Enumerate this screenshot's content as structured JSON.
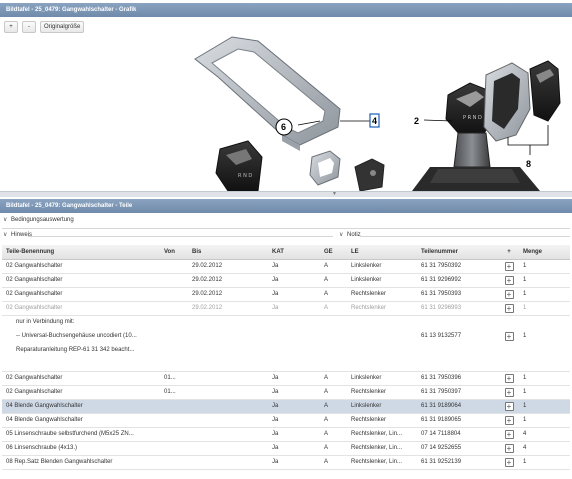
{
  "graphic_panel": {
    "title": "Bildtafel - 25_0479: Gangwahlschalter - Grafik",
    "zoom_in_label": "+",
    "zoom_out_label": "-",
    "original_size_label": "Originalgröße",
    "callouts": [
      "6",
      "4",
      "2",
      "8"
    ]
  },
  "parts_panel": {
    "title": "Bildtafel - 25_0479: Gangwahlschalter - Teile",
    "condition_label": "Bedingungsauswertung",
    "hint_label": "Hinweis",
    "note_label": "Notiz",
    "columns": [
      "Teile-Benennung",
      "Von",
      "Bis",
      "KAT",
      "GE",
      "LE",
      "Teilenummer",
      "+",
      "Menge"
    ],
    "rows": [
      {
        "name": "02 Gangwahlschalter",
        "von": "",
        "bis": "29.02.2012",
        "kat": "Ja",
        "ge": "A",
        "le": "Linkslenker",
        "tn": "61 31 7950392",
        "cart": "+",
        "menge": "1",
        "state": "normal"
      },
      {
        "name": "02 Gangwahlschalter",
        "von": "",
        "bis": "29.02.2012",
        "kat": "Ja",
        "ge": "A",
        "le": "Linkslenker",
        "tn": "61 31 9296992",
        "cart": "+",
        "menge": "1",
        "state": "normal"
      },
      {
        "name": "02 Gangwahlschalter",
        "von": "",
        "bis": "29.02.2012",
        "kat": "Ja",
        "ge": "A",
        "le": "Rechtslenker",
        "tn": "61 31 7950393",
        "cart": "+",
        "menge": "1",
        "state": "normal"
      },
      {
        "name": "02 Gangwahlschalter",
        "von": "",
        "bis": "29.02.2012",
        "kat": "Ja",
        "ge": "A",
        "le": "Rechtslenker",
        "tn": "61 31 9296993",
        "cart": "+",
        "menge": "1",
        "state": "dim"
      },
      {
        "name": "nur in Verbindung mit:",
        "von": "",
        "bis": "",
        "kat": "",
        "ge": "",
        "le": "",
        "tn": "",
        "cart": "",
        "menge": "",
        "state": "note"
      },
      {
        "name": "-- Universal-Buchsengehäuse uncodiert (10...",
        "von": "",
        "bis": "",
        "kat": "",
        "ge": "",
        "le": "",
        "tn": "61 13 9132577",
        "cart": "+",
        "menge": "1",
        "state": "note"
      },
      {
        "name": "Reparaturanleitung REP-61 31 342 beacht...",
        "von": "",
        "bis": "",
        "kat": "",
        "ge": "",
        "le": "",
        "tn": "",
        "cart": "",
        "menge": "",
        "state": "note"
      },
      {
        "name": "",
        "von": "",
        "bis": "",
        "kat": "",
        "ge": "",
        "le": "",
        "tn": "",
        "cart": "",
        "menge": "",
        "state": "blank"
      },
      {
        "name": "02 Gangwahlschalter",
        "von": "01...",
        "bis": "",
        "kat": "Ja",
        "ge": "A",
        "le": "Linkslenker",
        "tn": "61 31 7950396",
        "cart": "+",
        "menge": "1",
        "state": "normal"
      },
      {
        "name": "02 Gangwahlschalter",
        "von": "01...",
        "bis": "",
        "kat": "Ja",
        "ge": "A",
        "le": "Rechtslenker",
        "tn": "61 31 7950397",
        "cart": "+",
        "menge": "1",
        "state": "normal"
      },
      {
        "name": "04 Blende Gangwahlschalter",
        "von": "",
        "bis": "",
        "kat": "Ja",
        "ge": "A",
        "le": "Linkslenker",
        "tn": "61 31 9189064",
        "cart": "+",
        "menge": "1",
        "state": "selected"
      },
      {
        "name": "04 Blende Gangwahlschalter",
        "von": "",
        "bis": "",
        "kat": "Ja",
        "ge": "A",
        "le": "Rechtslenker",
        "tn": "61 31 9189065",
        "cart": "+",
        "menge": "1",
        "state": "normal"
      },
      {
        "name": "05 Linsenschraube selbstfurchend (M5x25 ZN...",
        "von": "",
        "bis": "",
        "kat": "Ja",
        "ge": "A",
        "le": "Rechtslenker, Lin...",
        "tn": "07 14 7118804",
        "cart": "+",
        "menge": "4",
        "state": "normal"
      },
      {
        "name": "06 Linsenschraube (4x13.)",
        "von": "",
        "bis": "",
        "kat": "Ja",
        "ge": "A",
        "le": "Rechtslenker, Lin...",
        "tn": "07 14 9252655",
        "cart": "+",
        "menge": "4",
        "state": "normal"
      },
      {
        "name": "08 Rep.Satz Blenden Gangwahlschalter",
        "von": "",
        "bis": "",
        "kat": "Ja",
        "ge": "A",
        "le": "Rechtslenker, Lin...",
        "tn": "61 31 9252139",
        "cart": "+",
        "menge": "1",
        "state": "normal"
      }
    ]
  },
  "colors": {
    "titlebar": "#7a94b4",
    "selected_row": "#cfd9e6",
    "callout_highlight": "#1c5fb8"
  },
  "icons": {
    "collapse": "chevron-down-icon",
    "add_to_cart": "plus-box-icon"
  }
}
